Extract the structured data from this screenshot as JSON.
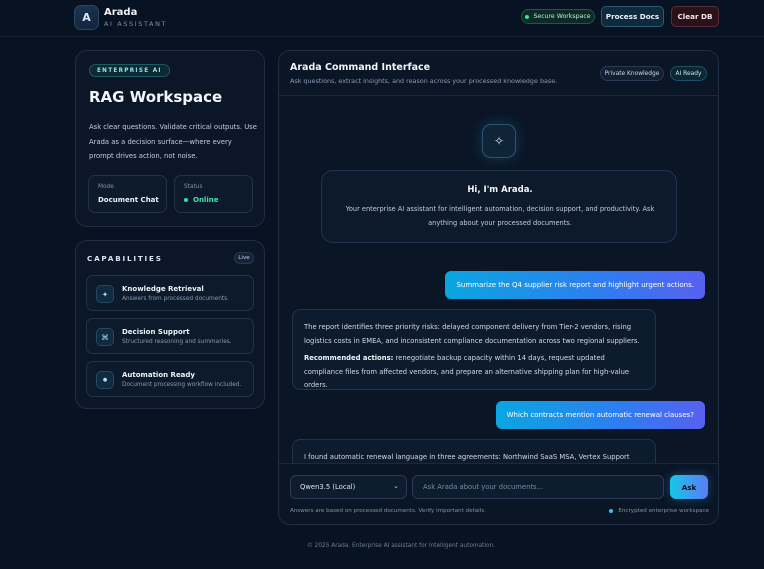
{
  "header": {
    "logo_letter": "A",
    "app_name": "Arada",
    "app_subtitle": "AI ASSISTANT",
    "secure_label": "Secure Workspace",
    "process_label": "Process Docs",
    "clear_label": "Clear DB"
  },
  "hero": {
    "tag": "ENTERPRISE AI",
    "title": "RAG Workspace",
    "description": "Ask clear questions. Validate critical outputs. Use Arada as a decision surface—where every prompt drives action, not noise.",
    "mode_label": "Mode",
    "mode_value": "Document Chat",
    "status_label": "Status",
    "status_value": "Online"
  },
  "capabilities": {
    "title": "CAPABILITIES",
    "badge": "Live",
    "items": [
      {
        "icon": "sparkle-icon",
        "glyph": "✦",
        "name": "Knowledge Retrieval",
        "desc": "Answers from processed documents."
      },
      {
        "icon": "command-icon",
        "glyph": "⌘",
        "name": "Decision Support",
        "desc": "Structured reasoning and summaries."
      },
      {
        "icon": "dot-icon",
        "glyph": "●",
        "name": "Automation Ready",
        "desc": "Document processing workflow included."
      }
    ]
  },
  "chat": {
    "title": "Arada Command Interface",
    "subtitle": "Ask questions, extract insights, and reason across your processed knowledge base.",
    "pill_private": "Private Knowledge",
    "pill_ready": "AI Ready",
    "welcome_icon": "✧",
    "welcome_title": "Hi, I'm Arada.",
    "welcome_body": "Your enterprise AI assistant for intelligent automation, decision support, and productivity. Ask anything about your processed documents.",
    "messages": [
      {
        "role": "user",
        "text": "Summarize the Q4 supplier risk report and highlight urgent actions."
      },
      {
        "role": "assistant",
        "p1": "The report identifies three priority risks: delayed component delivery from Tier-2 vendors, rising logistics costs in EMEA, and inconsistent compliance documentation across two regional suppliers.",
        "p2_bold": "Recommended actions:",
        "p2_rest": " renegotiate backup capacity within 14 days, request updated compliance files from affected vendors, and prepare an alternative shipping plan for high-value orders."
      },
      {
        "role": "user",
        "text": "Which contracts mention automatic renewal clauses?"
      },
      {
        "role": "assistant",
        "p1": "I found automatic renewal language in three agreements: Northwind SaaS MSA, Vertex Support"
      }
    ]
  },
  "composer": {
    "model": "Qwen3.5 (Local)",
    "placeholder": "Ask Arada about your documents...",
    "ask_label": "Ask",
    "disclaimer": "Answers are based on processed documents. Verify important details.",
    "encrypted": "Encrypted enterprise workspace"
  },
  "footer": "© 2025 Arada. Enterprise AI assistant for intelligent automation.",
  "colors": {
    "background": "#071223",
    "accent": "#1fb6e8",
    "online": "#2ee6a6"
  }
}
